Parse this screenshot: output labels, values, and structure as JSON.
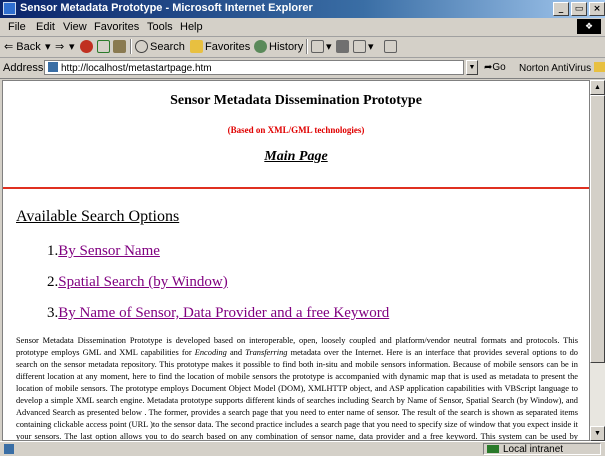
{
  "window": {
    "title": "Sensor Metadata Prototype - Microsoft Internet Explorer",
    "controls": [
      "_",
      "̆",
      "×"
    ]
  },
  "menu": [
    "File",
    "Edit",
    "View",
    "Favorites",
    "Tools",
    "Help"
  ],
  "toolbar": {
    "back": "Back",
    "search": "Search",
    "favorites": "Favorites",
    "history": "History"
  },
  "address": {
    "label": "Address",
    "url": "http://localhost/metastartpage.htm",
    "go": "Go",
    "norton": "Norton AntiVirus"
  },
  "page": {
    "title": "Sensor Metadata Dissemination Prototype",
    "subtitle": "(Based on XML/GML technologies)",
    "main_heading": "Main Page",
    "options_heading": "Available Search Options",
    "options": [
      {
        "num": "1.",
        "label": "By Sensor Name"
      },
      {
        "num": "2.",
        "label": "Spatial Search (by Window)"
      },
      {
        "num": "3.",
        "label": "By Name of Sensor, Data Provider and a free Keyword"
      }
    ],
    "body": [
      "Sensor Metadata Dissemination Prototype  is developed based on interoperable, open, loosely coupled and platform/vendor neutral formats and protocols. This prototype employs GML and XML capabilities for ",
      "Encoding",
      " and ",
      "Transferring",
      " metadata over the Internet. Here is an interface that provides several options to do search on the sensor metadata repository. This prototype makes it possible to find both in-situ and mobile sensors information. Because of mobile sensors can be in different location at any moment, here to find  the location of  mobile sensors the prototype is accompanied with dynamic map that is used as metadata to present the location of mobile sensors. The prototype employs Document Object Model (DOM), XMLHTTP object, and ASP application  capabilities with VBScript language to develop a simple XML  search engine. Metadata  prototype supports different  kinds of searches including Search by Name of Sensor,  Spatial Search (by Window), and Advanced Search as presented below . The former, provides a search page that you need to enter name of sensor. The result of the search is shown as separated items containing clickable access point (URL )to the sensor data. The second practice includes a search page that you need to specify size of window that you expect inside it your sensors. The last option allows you to do search based on any combination of sensor name, data provider and a free keyword. This system can be used by governmental and private organizations that are interested to"
    ]
  },
  "status": {
    "zone": "Local intranet"
  },
  "colors": {
    "titlebar": "#0a246a",
    "subtitle_red": "#e00000",
    "rule_red": "#e03020",
    "visited_link": "#800080"
  }
}
